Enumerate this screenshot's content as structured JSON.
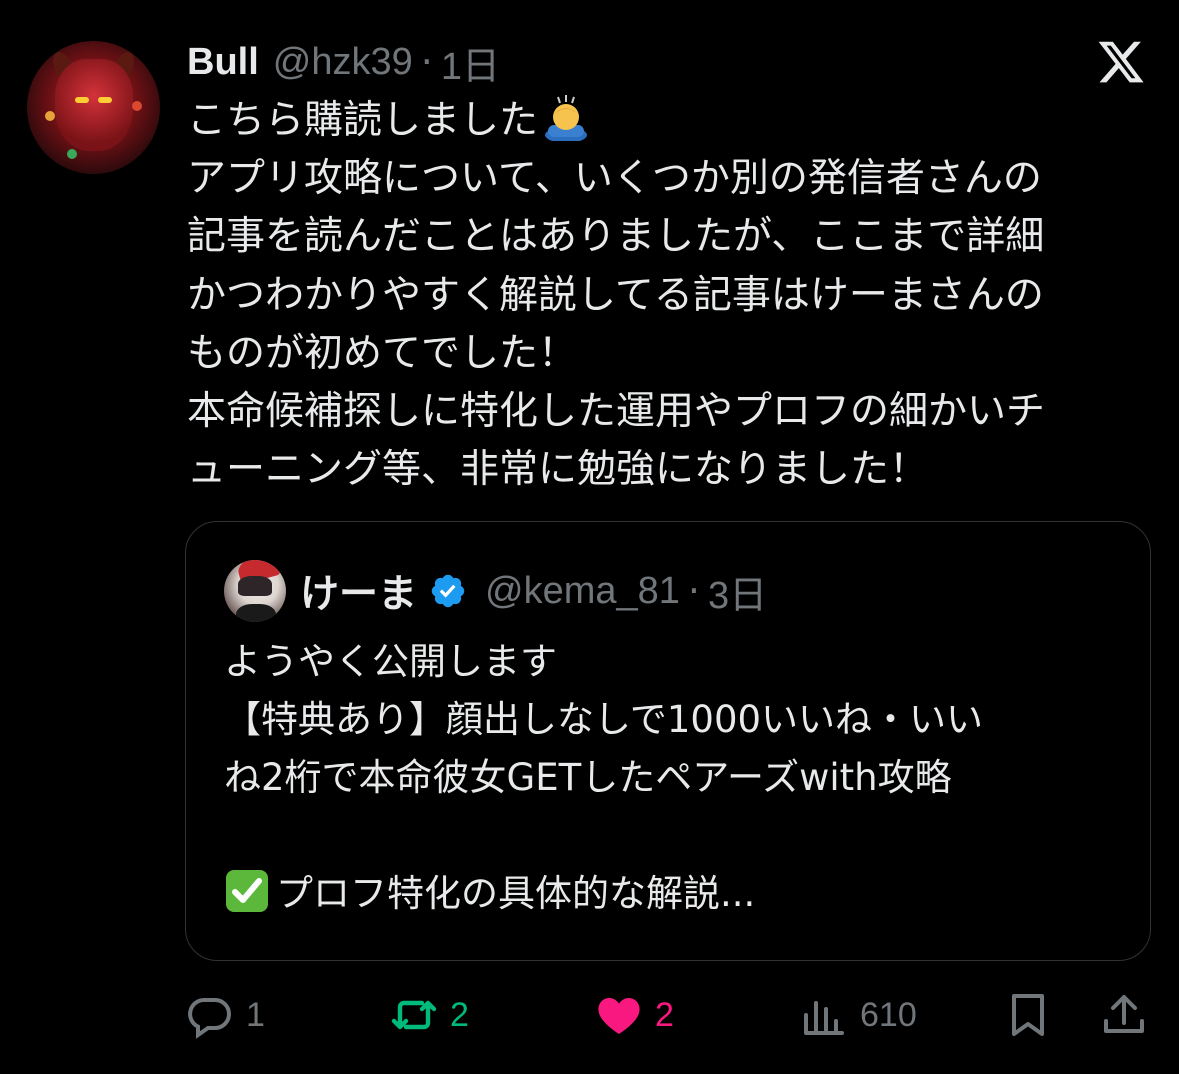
{
  "tweet": {
    "author_name": "Bull",
    "handle": "@hzk39",
    "separator": "·",
    "time": "1日",
    "lines": [
      "こちら購読しました",
      "アプリ攻略について、いくつか別の発信者さんの",
      "記事を読んだことはありましたが、ここまで詳細",
      "かつわかりやすく解説してる記事はけーまさんの",
      "ものが初めてでした！",
      "本命候補探しに特化した運用やプロフの細かいチ",
      "ューニング等、非常に勉強になりました！"
    ],
    "emoji_after_first_line": "person-bowing-emoji"
  },
  "quote": {
    "author_name": "けーま",
    "verified": true,
    "handle": "@kema_81",
    "separator": "·",
    "time": "3日",
    "lines": [
      "ようやく公開します",
      "【特典あり】顔出しなしで1000いいね・いい",
      "ね2桁で本命彼女GETしたペアーズwith攻略",
      "",
      "プロフ特化の具体的な解説..."
    ],
    "check_emoji": "check-mark-button-emoji"
  },
  "actions": {
    "reply_count": "1",
    "retweet_count": "2",
    "like_count": "2",
    "view_count": "610"
  },
  "colors": {
    "background": "#000000",
    "text": "#e7e9ea",
    "muted": "#71767b",
    "retweet": "#00ba7c",
    "like": "#f91880",
    "verified": "#1d9bf0"
  }
}
